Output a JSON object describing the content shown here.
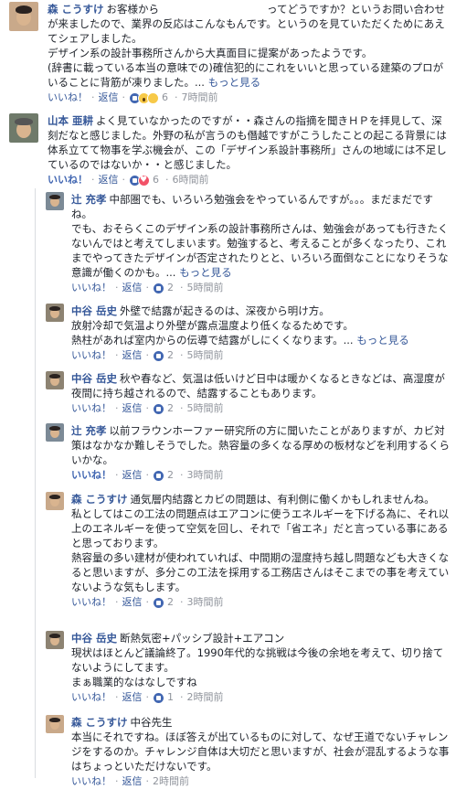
{
  "comments": [
    {
      "name": "森 こうすけ",
      "text1": "お客様から",
      "text2": "ってどうですか？というお問い合わせが来ましたので、業界の反応はこんなもんです。というのを見ていただくためにあえてシェアしました。",
      "text3": "デザイン系の設計事務所さんから大真面目に提案があったようです。",
      "text4": "(辞書に載っている本当の意味での)確信犯的にこれをいいと思っている建築のプロがいることに背筋が凍りました。...",
      "more": "もっと見る",
      "like": "いいね！",
      "reply": "返信",
      "reactions": "6",
      "time": "7時間前"
    },
    {
      "name": "山本 亜耕",
      "text": "よく見ていなかったのですが・・森さんの指摘を聞きＨＰを拝見して、深刻だなと感じました。外野の私が言うのも僭越ですがこうしたことの起こる背景には体系立てて物事を学ぶ機会が、この「デザイン系設計事務所」さんの地域には不足しているのではないか・・と感じました。",
      "like": "いいね！",
      "reply": "返信",
      "reactions": "6",
      "time": "6時間前"
    }
  ],
  "replies": [
    {
      "name": "辻 充孝",
      "text1": "中部圏でも、いろいろ勉強会をやっているんですが。。。まだまだですね。",
      "text2": "でも、おそらくこのデザイン系の設計事務所さんは、勉強会があっても行きたくないんではと考えてしまいます。勉強すると、考えることが多くなったり、これまでやってきたデザインが否定されたりとと、いろいろ面倒なことになりそうな意識が働くのかも。...",
      "more": "もっと見る",
      "like": "いいね！",
      "reply": "返信",
      "reactions": "2",
      "time": "5時間前"
    },
    {
      "name": "中谷 岳史",
      "text1": "外壁で結露が起きるのは、深夜から明け方。",
      "text2": "放射冷却で気温より外壁が露点温度より低くなるためです。",
      "text3": "熱柱があれば室内からの伝導で結露がしにくくなります。...",
      "more": "もっと見る",
      "like": "いいね！",
      "reply": "返信",
      "reactions": "2",
      "time": "5時間前"
    },
    {
      "name": "中谷 岳史",
      "text": "秋や春など、気温は低いけど日中は暖かくなるときなどは、高湿度が夜間に持ち越されるので、結露することもあります。",
      "like": "いいね！",
      "reply": "返信",
      "reactions": "2",
      "time": "5時間前"
    },
    {
      "name": "辻 充孝",
      "text": "以前フラウンホーファー研究所の方に聞いたことがありますが、カビ対策はなかなか難しそうでした。熱容量の多くなる厚めの板材などを利用するくらいかな。",
      "like": "いいね！",
      "reply": "返信",
      "reactions": "2",
      "time": "3時間前"
    },
    {
      "name": "森 こうすけ",
      "text1": "通気層内結露とカビの問題は、有利側に働くかもしれませんね。",
      "text2": "私としてはこの工法の問題点はエアコンに使うエネルギーを下げる為に、それ以上のエネルギーを使って空気を回し、それで「省エネ」だと言っている事にあると思っております。",
      "text3": "熱容量の多い建材が使われていれば、中間期の湿度持ち越し問題なども大きくなると思いますが、多分この工法を採用する工務店さんはそこまでの事を考えていないような気もします。",
      "like": "いいね！",
      "reply": "返信",
      "reactions": "2",
      "time": "3時間前"
    },
    {
      "name": "中谷 岳史",
      "text1": "断熱気密+パッシブ設計+エアコン",
      "text2": "現状はほとんど議論終了。1990年代的な挑戦は今後の余地を考えて、切り捨てないようにしてます。",
      "text3": "まぁ職業的なはなしですね",
      "like": "いいね！",
      "reply": "返信",
      "reactions": "1",
      "time": "2時間前"
    },
    {
      "name": "森 こうすけ",
      "text1": "中谷先生",
      "text2": "本当にそれですね。ほぼ答えが出ているものに対して、なぜ王道でないチャレンジをするのか。チャレンジ自体は大切だと思いますが、社会が混乱するような事はちょっといただけないです。",
      "like": "いいね！",
      "reply": "返信",
      "time": "2時間前"
    }
  ]
}
